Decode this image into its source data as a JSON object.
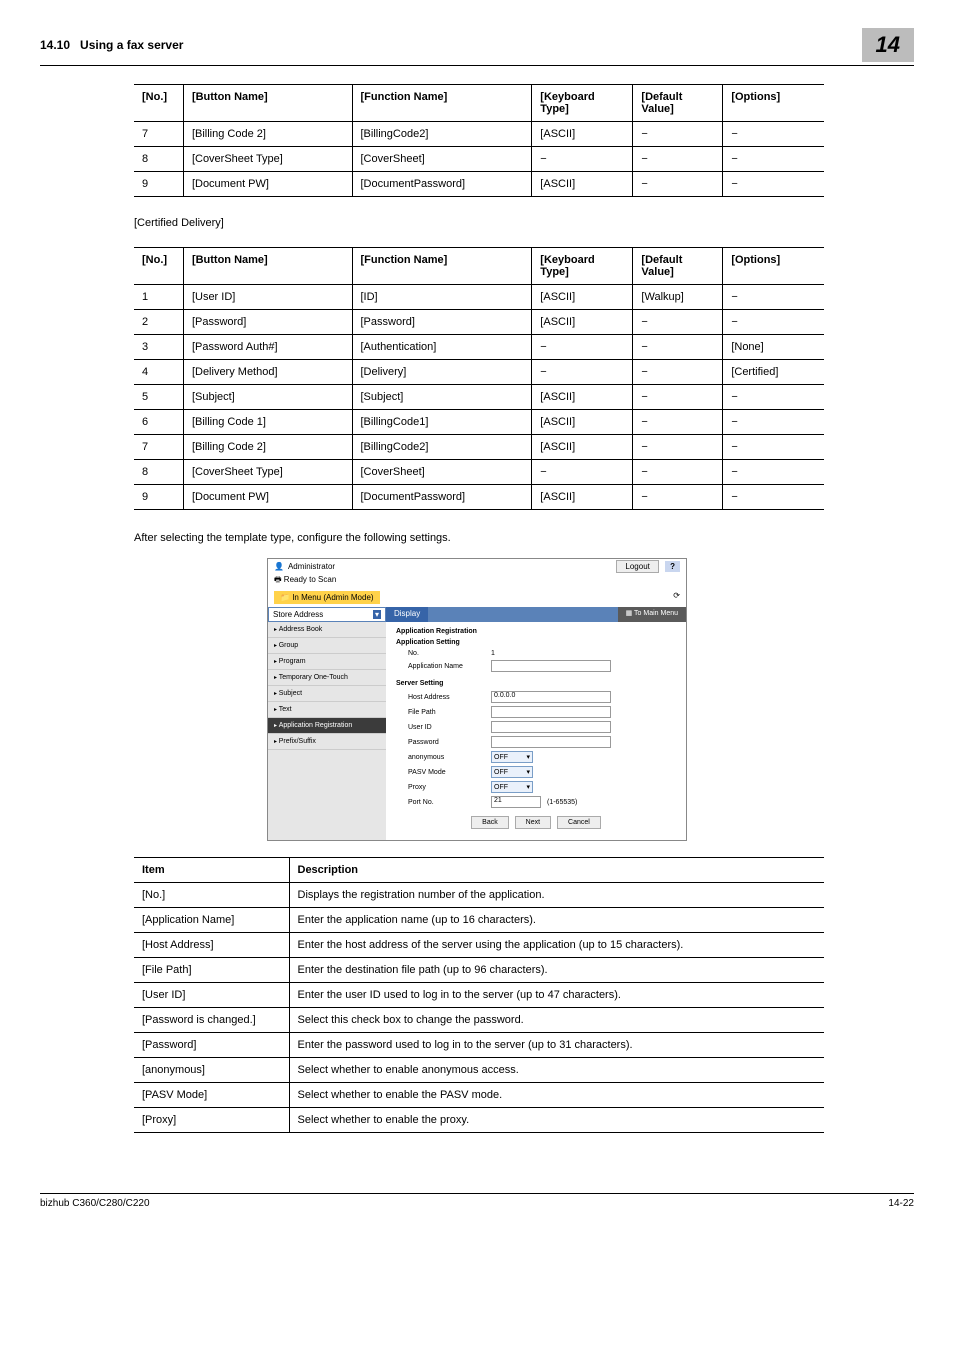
{
  "header": {
    "section": "14.10",
    "title": "Using a fax server",
    "chapter": "14"
  },
  "t1": {
    "headers": [
      "[No.]",
      "[Button Name]",
      "[Function Name]",
      "[Keyboard Type]",
      "[Default Value]",
      "[Options]"
    ],
    "rows": [
      [
        "7",
        "[Billing Code 2]",
        "[BillingCode2]",
        "[ASCII]",
        "−",
        "−"
      ],
      [
        "8",
        "[CoverSheet Type]",
        "[CoverSheet]",
        "−",
        "−",
        "−"
      ],
      [
        "9",
        "[Document PW]",
        "[DocumentPassword]",
        "[ASCII]",
        "−",
        "−"
      ]
    ]
  },
  "subhead": "[Certified Delivery]",
  "t2": {
    "headers": [
      "[No.]",
      "[Button Name]",
      "[Function Name]",
      "[Keyboard Type]",
      "[Default Value]",
      "[Options]"
    ],
    "rows": [
      [
        "1",
        "[User ID]",
        "[ID]",
        "[ASCII]",
        "[Walkup]",
        "−"
      ],
      [
        "2",
        "[Password]",
        "[Password]",
        "[ASCII]",
        "−",
        "−"
      ],
      [
        "3",
        "[Password Auth#]",
        "[Authentication]",
        "−",
        "−",
        "[None]"
      ],
      [
        "4",
        "[Delivery Method]",
        "[Delivery]",
        "−",
        "−",
        "[Certified]"
      ],
      [
        "5",
        "[Subject]",
        "[Subject]",
        "[ASCII]",
        "−",
        "−"
      ],
      [
        "6",
        "[Billing Code 1]",
        "[BillingCode1]",
        "[ASCII]",
        "−",
        "−"
      ],
      [
        "7",
        "[Billing Code 2]",
        "[BillingCode2]",
        "[ASCII]",
        "−",
        "−"
      ],
      [
        "8",
        "[CoverSheet Type]",
        "[CoverSheet]",
        "−",
        "−",
        "−"
      ],
      [
        "9",
        "[Document PW]",
        "[DocumentPassword]",
        "[ASCII]",
        "−",
        "−"
      ]
    ]
  },
  "para": "After selecting the template type, configure the following settings.",
  "shot": {
    "admin": "Administrator",
    "logout": "Logout",
    "help": "?",
    "ready": "Ready to Scan",
    "mode": "In Menu (Admin Mode)",
    "store": "Store Address",
    "display": "Display",
    "mainmenu": "To Main Menu",
    "nav": [
      "Address Book",
      "Group",
      "Program",
      "Temporary One-Touch",
      "Subject",
      "Text",
      "Application Registration",
      "Prefix/Suffix"
    ],
    "h1": "Application Registration",
    "h2": "Application Setting",
    "no_lbl": "No.",
    "no_val": "1",
    "appname_lbl": "Application Name",
    "h3": "Server Setting",
    "host_lbl": "Host Address",
    "host_val": "0.0.0.0",
    "filepath_lbl": "File Path",
    "userid_lbl": "User ID",
    "password_lbl": "Password",
    "anon_lbl": "anonymous",
    "pasv_lbl": "PASV Mode",
    "proxy_lbl": "Proxy",
    "port_lbl": "Port No.",
    "port_val": "21",
    "port_range": "(1-65535)",
    "off": "OFF",
    "back": "Back",
    "next": "Next",
    "cancel": "Cancel"
  },
  "desc": {
    "headers": [
      "Item",
      "Description"
    ],
    "rows": [
      [
        "[No.]",
        "Displays the registration number of the application."
      ],
      [
        "[Application Name]",
        "Enter the application name (up to 16 characters)."
      ],
      [
        "[Host Address]",
        "Enter the host address of the server using the application (up to 15 characters)."
      ],
      [
        "[File Path]",
        "Enter the destination file path (up to 96 characters)."
      ],
      [
        "[User ID]",
        "Enter the user ID used to log in to the server (up to 47 characters)."
      ],
      [
        "[Password is changed.]",
        "Select this check box to change the password."
      ],
      [
        "[Password]",
        "Enter the password used to log in to the server (up to 31 characters)."
      ],
      [
        "[anonymous]",
        "Select whether to enable anonymous access."
      ],
      [
        "[PASV Mode]",
        "Select whether to enable the PASV mode."
      ],
      [
        "[Proxy]",
        "Select whether to enable the proxy."
      ]
    ]
  },
  "footer": {
    "left": "bizhub C360/C280/C220",
    "right": "14-22"
  }
}
